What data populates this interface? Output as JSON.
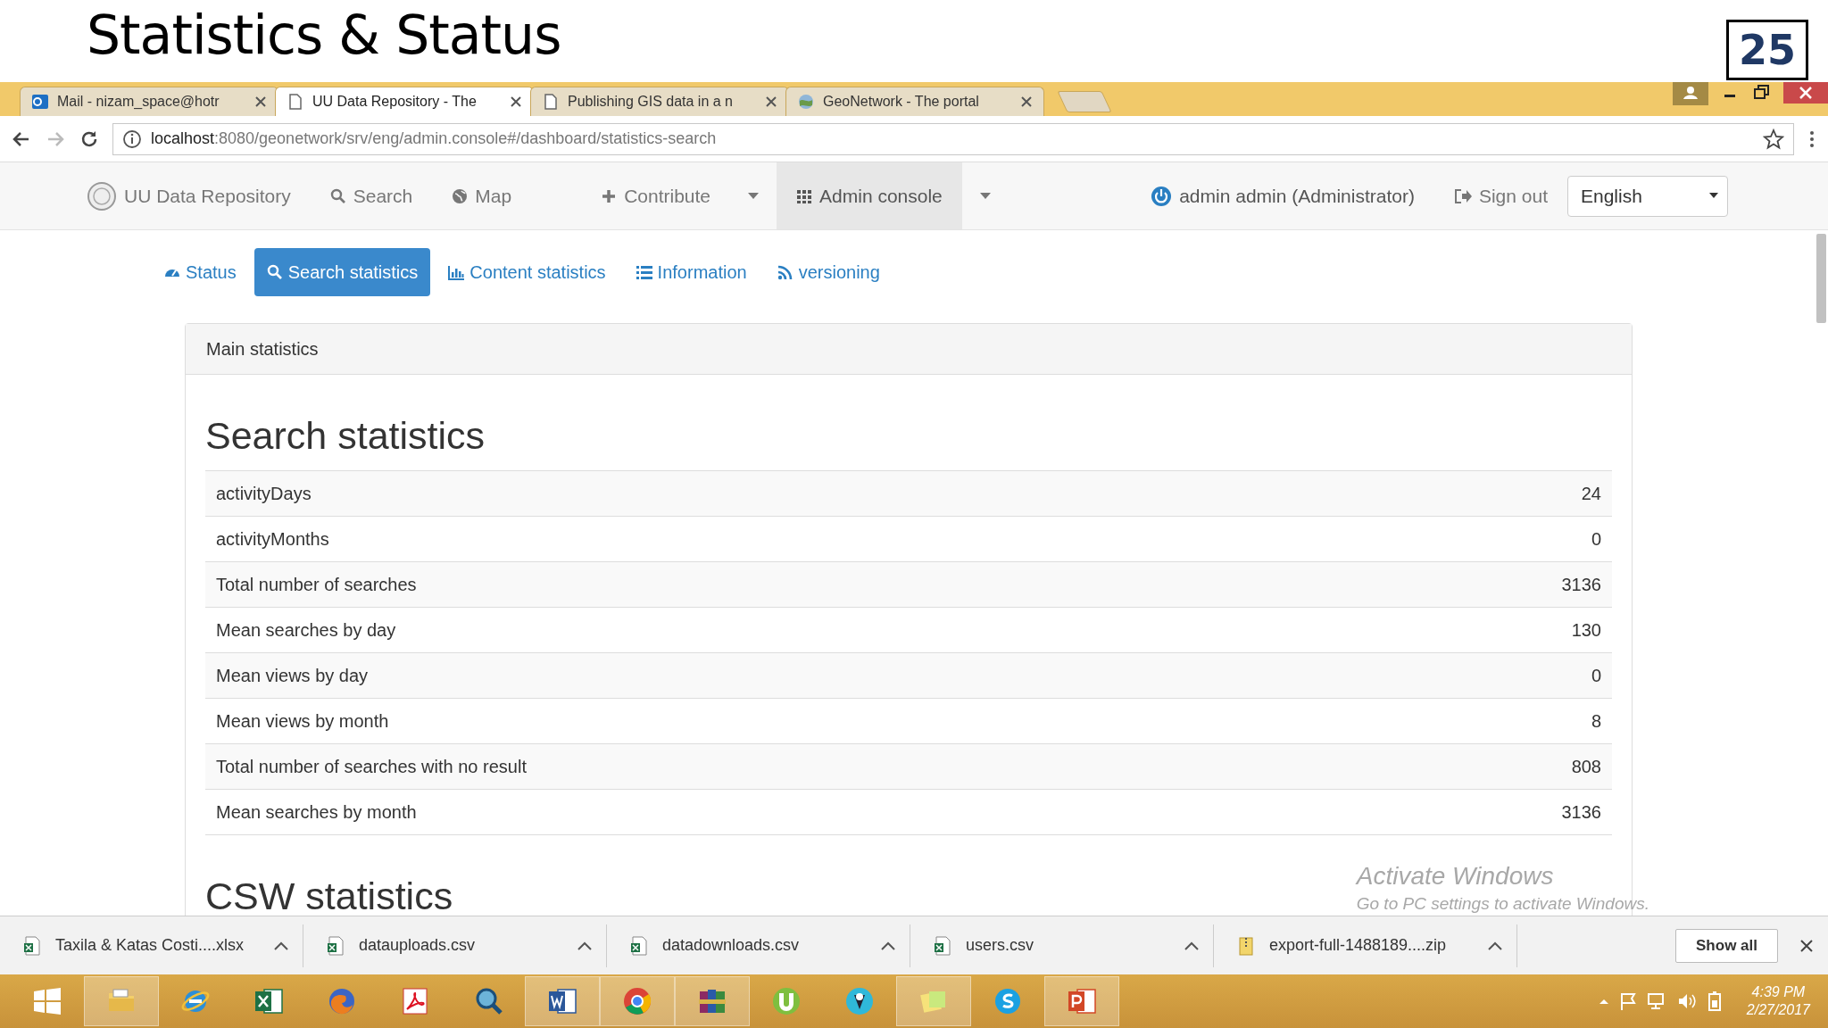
{
  "slide": {
    "title": "Statistics & Status",
    "page_number": "25"
  },
  "browser": {
    "tabs": [
      {
        "title": "Mail - nizam_space@hotr",
        "selected": false
      },
      {
        "title": "UU Data Repository - The",
        "selected": true
      },
      {
        "title": "Publishing GIS data in a n",
        "selected": false
      },
      {
        "title": "GeoNetwork - The portal",
        "selected": false
      }
    ],
    "address_host": "localhost",
    "address_path": ":8080/geonetwork/srv/eng/admin.console#/dashboard/statistics-search"
  },
  "navbar": {
    "brand": "UU Data Repository",
    "items": [
      {
        "label": "Search",
        "selected": false,
        "dropdown": false
      },
      {
        "label": "Map",
        "selected": false,
        "dropdown": false
      },
      {
        "label": "Contribute",
        "selected": false,
        "dropdown": true
      },
      {
        "label": "Admin console",
        "selected": true,
        "dropdown": true
      }
    ],
    "user": "admin admin (Administrator)",
    "sign_out": "Sign out",
    "language": "English"
  },
  "subtabs": [
    {
      "label": "Status",
      "selected": false
    },
    {
      "label": "Search statistics",
      "selected": true
    },
    {
      "label": "Content statistics",
      "selected": false
    },
    {
      "label": "Information",
      "selected": false
    },
    {
      "label": "versioning",
      "selected": false
    }
  ],
  "panel": {
    "heading": "Main statistics",
    "sections": [
      {
        "title": "Search statistics",
        "rows": [
          {
            "label": "activityDays",
            "value": "24"
          },
          {
            "label": "activityMonths",
            "value": "0"
          },
          {
            "label": "Total number of searches",
            "value": "3136"
          },
          {
            "label": "Mean searches by day",
            "value": "130"
          },
          {
            "label": "Mean views by day",
            "value": "0"
          },
          {
            "label": "Mean views by month",
            "value": "8"
          },
          {
            "label": "Total number of searches with no result",
            "value": "808"
          },
          {
            "label": "Mean searches by month",
            "value": "3136"
          }
        ]
      },
      {
        "title": "CSW statistics"
      }
    ]
  },
  "watermark": {
    "title": "Activate Windows",
    "subtitle": "Go to PC settings to activate Windows."
  },
  "downloads": {
    "files": [
      {
        "name": "Taxila & Katas Costi....xlsx",
        "kind": "sheet"
      },
      {
        "name": "datauploads.csv",
        "kind": "sheet"
      },
      {
        "name": "datadownloads.csv",
        "kind": "sheet"
      },
      {
        "name": "users.csv",
        "kind": "sheet"
      },
      {
        "name": "export-full-1488189....zip",
        "kind": "archive"
      }
    ],
    "show_all": "Show all"
  },
  "taskbar": {
    "time": "4:39 PM",
    "date": "2/27/2017"
  }
}
